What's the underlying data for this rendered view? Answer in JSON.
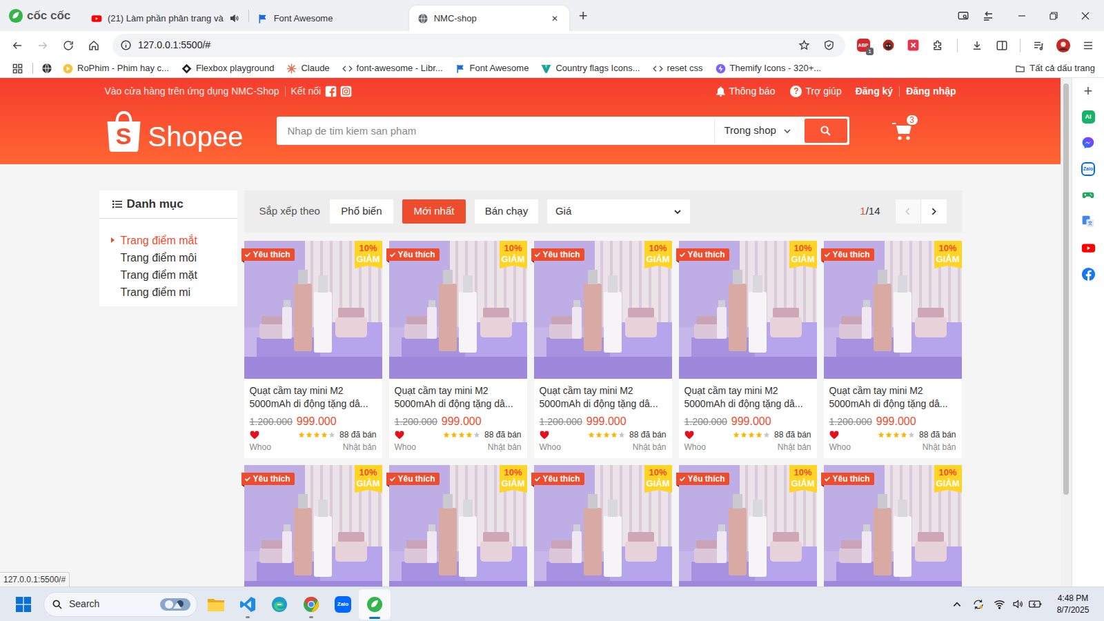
{
  "browser": {
    "brand": "cốc cốc",
    "tabs": [
      {
        "label": "(21) Làm phần phân trang và",
        "selected": false,
        "kind": "youtube",
        "audio": true
      },
      {
        "label": "Font Awesome",
        "selected": false,
        "kind": "flag",
        "audio": false
      },
      {
        "label": "NMC-shop",
        "selected": true,
        "kind": "globe",
        "audio": false
      }
    ],
    "close_tab": "✕",
    "new_tab": "+",
    "forward_disabled": true,
    "url": "127.0.0.1:5500/#",
    "extension_label": "ABP",
    "extension_badge": "1",
    "bookmarks": [
      {
        "label": "RoPhim - Phim hay c...",
        "kind": "rophim"
      },
      {
        "label": "Flexbox playground",
        "kind": "flexbox"
      },
      {
        "label": "Claude",
        "kind": "claude"
      },
      {
        "label": "font-awesome - Libr...",
        "kind": "code"
      },
      {
        "label": "Font Awesome",
        "kind": "flag"
      },
      {
        "label": "Country flags Icons...",
        "kind": "vicon"
      },
      {
        "label": "reset css",
        "kind": "code"
      },
      {
        "label": "Themify Icons - 320+...",
        "kind": "themify"
      }
    ],
    "all_bookmarks": "Tất cả dấu trang",
    "status_url": "127.0.0.1:5500/#"
  },
  "side_panel": {
    "add": "+",
    "ai": "AI",
    "zalo": "Zalo"
  },
  "header": {
    "navbar": {
      "app": "Vào cửa hàng trên ứng dụng NMC-Shop",
      "connect": "Kết nối",
      "notify": "Thông báo",
      "help_icon": "?",
      "help": "Trợ giúp",
      "register": "Đăng ký",
      "login": "Đăng nhập"
    },
    "logo_mark": "S",
    "logo": "Shopee",
    "search": {
      "placeholder": "Nhap de tim kiem san pham",
      "scope": "Trong shop"
    },
    "cart_count": "3"
  },
  "category": {
    "title": "Danh mục",
    "items": [
      {
        "label": "Trang điểm mắt",
        "selected": true
      },
      {
        "label": "Trang điểm môi",
        "selected": false
      },
      {
        "label": "Trang điểm mặt",
        "selected": false
      },
      {
        "label": "Trang điểm mi",
        "selected": false
      }
    ]
  },
  "sort": {
    "label": "Sắp xếp theo",
    "options": [
      {
        "label": "Phổ biến",
        "selected": false
      },
      {
        "label": "Mới nhất",
        "selected": true
      },
      {
        "label": "Bán chạy",
        "selected": false
      }
    ],
    "price": "Giá",
    "page_current": "1",
    "page_total": "/14",
    "prev_disabled": true
  },
  "products": [
    {
      "favourite": "Yêu thích",
      "discount_percent": "10%",
      "discount_label": "GIẢM",
      "name": "Quạt cầm tay mini M2 5000mAh di động tặng dâ...",
      "old_price": "1.200.000",
      "price": "999.000",
      "liked": true,
      "stars": 4,
      "sold": "88 đã bán",
      "brand": "Whoo",
      "origin": "Nhật bản"
    },
    {
      "favourite": "Yêu thích",
      "discount_percent": "10%",
      "discount_label": "GIẢM",
      "name": "Quạt cầm tay mini M2 5000mAh di động tặng dâ...",
      "old_price": "1.200.000",
      "price": "999.000",
      "liked": true,
      "stars": 4,
      "sold": "88 đã bán",
      "brand": "Whoo",
      "origin": "Nhật bản"
    },
    {
      "favourite": "Yêu thích",
      "discount_percent": "10%",
      "discount_label": "GIẢM",
      "name": "Quạt cầm tay mini M2 5000mAh di động tặng dâ...",
      "old_price": "1.200.000",
      "price": "999.000",
      "liked": true,
      "stars": 4,
      "sold": "88 đã bán",
      "brand": "Whoo",
      "origin": "Nhật bản"
    },
    {
      "favourite": "Yêu thích",
      "discount_percent": "10%",
      "discount_label": "GIẢM",
      "name": "Quạt cầm tay mini M2 5000mAh di động tặng dâ...",
      "old_price": "1.200.000",
      "price": "999.000",
      "liked": true,
      "stars": 4,
      "sold": "88 đã bán",
      "brand": "Whoo",
      "origin": "Nhật bản"
    },
    {
      "favourite": "Yêu thích",
      "discount_percent": "10%",
      "discount_label": "GIẢM",
      "name": "Quạt cầm tay mini M2 5000mAh di động tặng dâ...",
      "old_price": "1.200.000",
      "price": "999.000",
      "liked": true,
      "stars": 4,
      "sold": "88 đã bán",
      "brand": "Whoo",
      "origin": "Nhật bản"
    },
    {
      "favourite": "Yêu thích",
      "discount_percent": "10%",
      "discount_label": "GIẢM"
    },
    {
      "favourite": "Yêu thích",
      "discount_percent": "10%",
      "discount_label": "GIẢM"
    },
    {
      "favourite": "Yêu thích",
      "discount_percent": "10%",
      "discount_label": "GIẢM"
    },
    {
      "favourite": "Yêu thích",
      "discount_percent": "10%",
      "discount_label": "GIẢM"
    },
    {
      "favourite": "Yêu thích",
      "discount_percent": "10%",
      "discount_label": "GIẢM"
    }
  ],
  "taskbar": {
    "search": "Search",
    "zalo": "Zalo",
    "time": "4:48 PM",
    "date": "8/7/2025"
  }
}
